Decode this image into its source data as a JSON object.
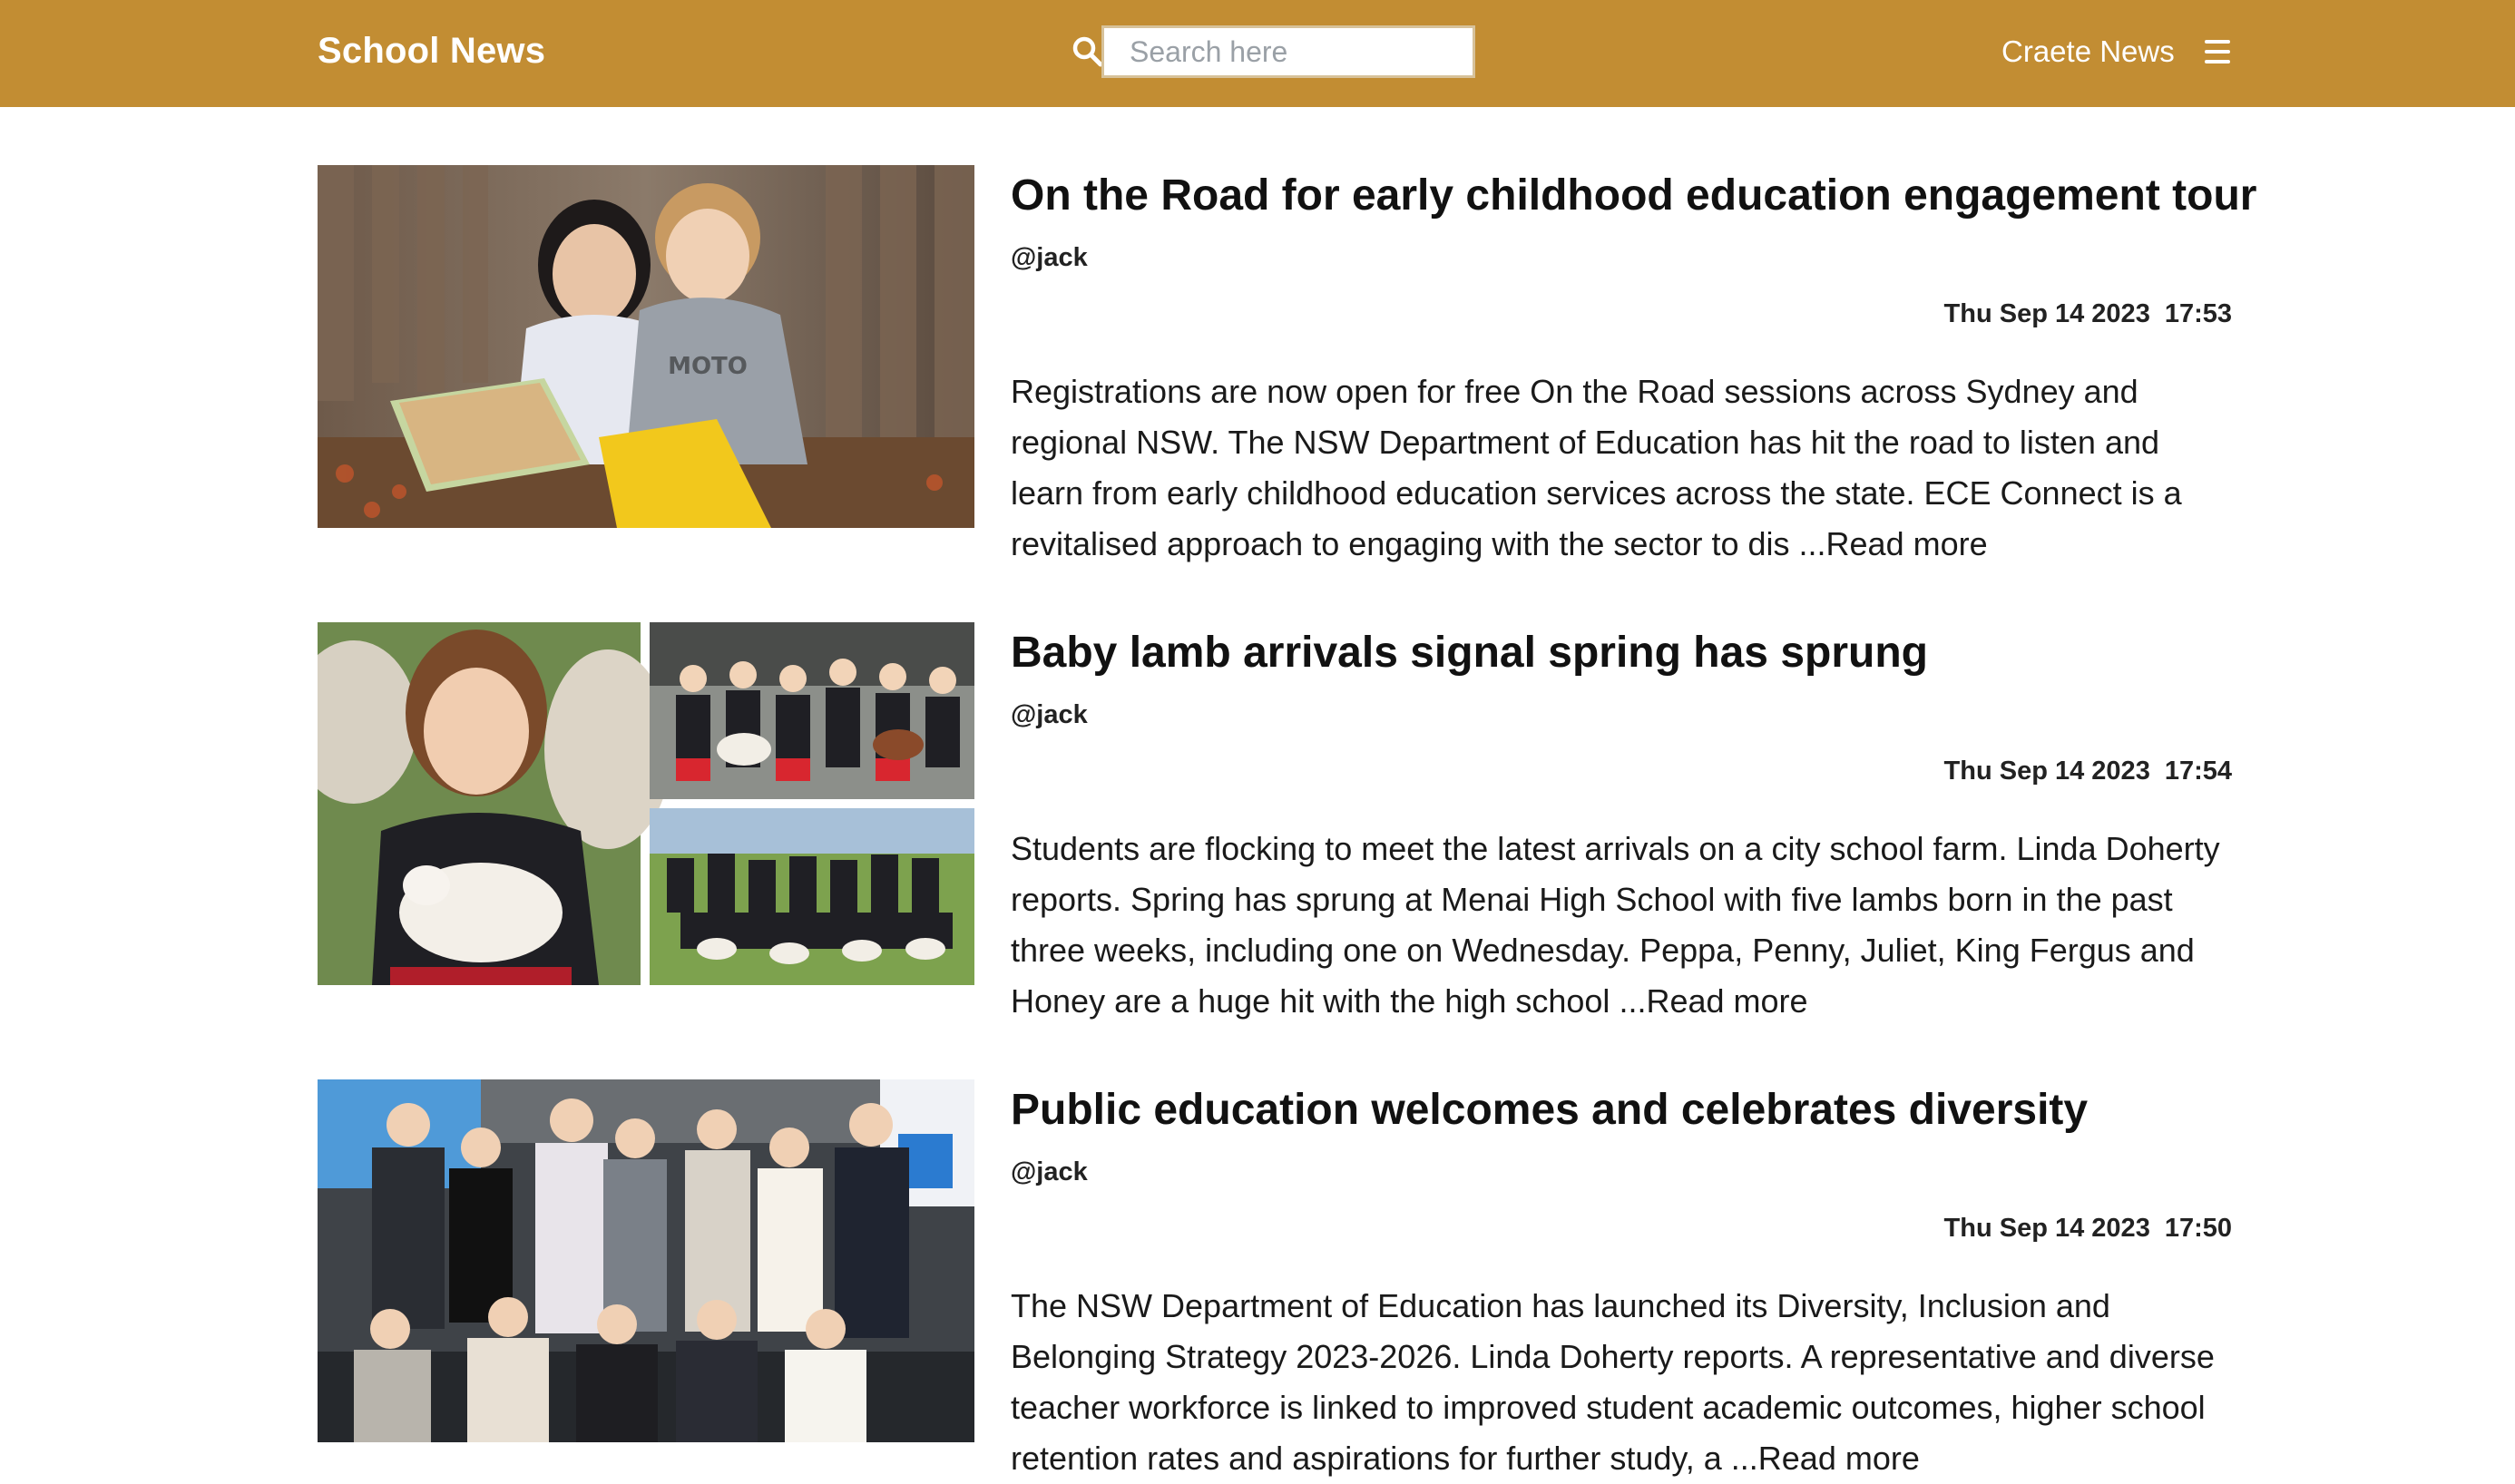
{
  "header": {
    "brand": "School News",
    "search_placeholder": "Search here",
    "search_value": "",
    "create_label": "Craete News",
    "menu_icon": "hamburger-menu-icon",
    "background_color": "#c28d33"
  },
  "articles": [
    {
      "title": "On the Road for early childhood education engagement tour",
      "author": "@jack",
      "date": "Thu Sep 14 2023",
      "time": "17:53",
      "excerpt": "Registrations are now open for free On the Road sessions across Sydney and regional NSW. The NSW Department of Education has hit the road to listen and learn from early childhood education services across the state. ECE Connect is a revitalised approach to engaging with the sector to dis",
      "read_more": "...Read more",
      "image": "children-reading-book-photo"
    },
    {
      "title": "Baby lamb arrivals signal spring has sprung",
      "author": "@jack",
      "date": "Thu Sep 14 2023",
      "time": "17:54",
      "excerpt": "Students are flocking to meet the latest arrivals on a city school farm. Linda Doherty reports. Spring has sprung at Menai High School with five lambs born in the past three weeks, including one on Wednesday. Peppa, Penny, Juliet, King Fergus and Honey are a huge hit with the high school",
      "read_more": "...Read more",
      "image": "students-with-lambs-collage"
    },
    {
      "title": "Public education welcomes and celebrates diversity",
      "author": "@jack",
      "date": "Thu Sep 14 2023",
      "time": "17:50",
      "excerpt": "The NSW Department of Education has launched its Diversity, Inclusion and Belonging Strategy 2023-2026. Linda Doherty reports. A representative and diverse teacher workforce is linked to improved student academic outcomes, higher school retention rates and aspirations for further study, a",
      "read_more": "...Read more",
      "image": "group-photo-diversity-event"
    }
  ]
}
